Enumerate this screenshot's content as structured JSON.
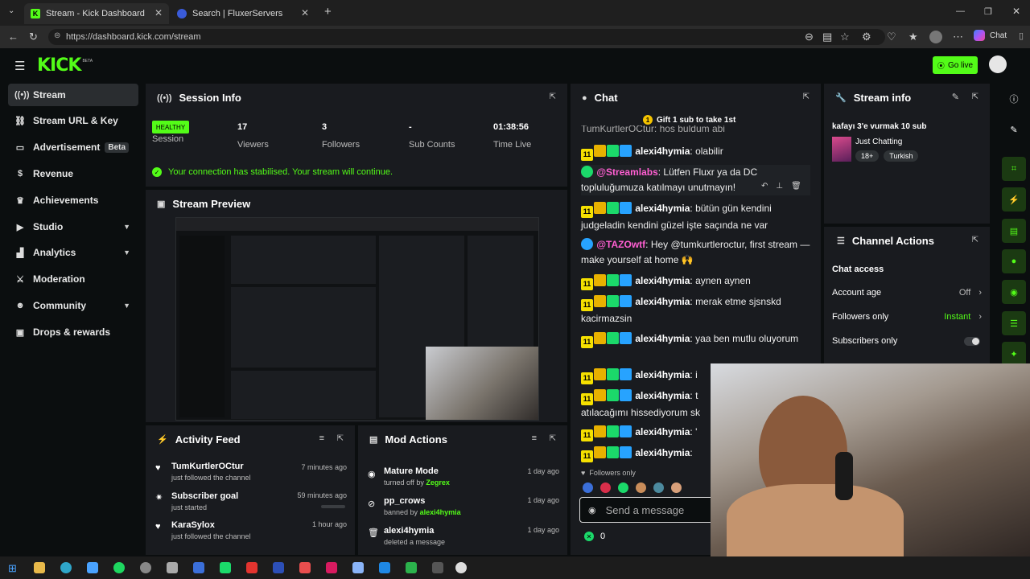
{
  "browser": {
    "tabs": [
      {
        "label": "Stream - Kick Dashboard"
      },
      {
        "label": "Search | FluxerServers"
      }
    ],
    "url": "https://dashboard.kick.com/stream",
    "copilot_label": "Chat"
  },
  "header": {
    "logo": "KICK",
    "logo_sup": "BETA",
    "go_live": "Go live"
  },
  "sidebar": {
    "items": [
      {
        "label": "Stream",
        "icon": "broadcast-icon"
      },
      {
        "label": "Stream URL & Key",
        "icon": "link-icon"
      },
      {
        "label": "Advertisement",
        "badge": "Beta",
        "icon": "tv-icon"
      },
      {
        "label": "Revenue",
        "icon": "dollar-icon"
      },
      {
        "label": "Achievements",
        "icon": "trophy-icon"
      },
      {
        "label": "Studio",
        "icon": "play-icon"
      },
      {
        "label": "Analytics",
        "icon": "chart-icon"
      },
      {
        "label": "Moderation",
        "icon": "sword-icon"
      },
      {
        "label": "Community",
        "icon": "people-icon"
      },
      {
        "label": "Drops & rewards",
        "icon": "gift-icon"
      }
    ]
  },
  "session": {
    "title": "Session Info",
    "health": "HEALTHY",
    "session_label": "Session",
    "viewers": "17",
    "viewers_label": "Viewers",
    "followers": "3",
    "followers_label": "Followers",
    "subs": "-",
    "subs_label": "Sub Counts",
    "time": "01:38:56",
    "time_label": "Time Live",
    "notice": "Your connection has stabilised. Your stream will continue."
  },
  "preview": {
    "title": "Stream Preview"
  },
  "activity": {
    "title": "Activity Feed",
    "items": [
      {
        "title": "TumKurtlerOCtur",
        "sub": "just followed the channel",
        "time": "7 minutes ago"
      },
      {
        "title": "Subscriber goal",
        "sub": "just started",
        "time": "59 minutes ago"
      },
      {
        "title": "KaraSylox",
        "sub": "just followed the channel",
        "time": "1 hour ago"
      }
    ]
  },
  "mod": {
    "title": "Mod Actions",
    "items": [
      {
        "title": "Mature Mode",
        "sub": "turned off by",
        "who": "Zegrex",
        "time": "1 day ago"
      },
      {
        "title": "pp_crows",
        "sub": "banned by",
        "who": "alexi4hymia",
        "time": "1 day ago"
      },
      {
        "title": "alexi4hymia",
        "sub": "deleted a message",
        "who": "",
        "time": "1 day ago"
      }
    ]
  },
  "chat": {
    "title": "Chat",
    "gift": "Gift 1 sub to take 1st",
    "cut_top": "TumKurtlerOCtur: hoş buldum abi",
    "messages": [
      {
        "user": "alexi4hymia",
        "text": "olabilir"
      },
      {
        "user": "@Streamlabs",
        "text": "Lütfen Fluxr ya da DC topluluğumuza katılmayı unutmayın!"
      },
      {
        "user": "alexi4hymia",
        "text": "bütün gün kendini judgeladin kendini güzel işte saçında ne var"
      },
      {
        "user": "@TAZOwtf",
        "text": "Hey @tumkurtleroctur, first stream — make yourself at home 🙌"
      },
      {
        "user": "alexi4hymia",
        "text": "aynen aynen"
      },
      {
        "user": "alexi4hymia",
        "text": "merak etme sjsnskd kacirmazsin"
      },
      {
        "user": "alexi4hymia",
        "text": "yaa ben mutlu oluyorum"
      },
      {
        "user": "alexi4hymia",
        "text": "i"
      },
      {
        "user": "alexi4hymia",
        "text": "t atılacağımı hissediyorum sk"
      },
      {
        "user": "alexi4hymia",
        "text": "'"
      },
      {
        "user": "alexi4hymia",
        "text": ""
      }
    ],
    "followers_only": "Followers only",
    "placeholder": "Send a message",
    "points": "0"
  },
  "stream_info": {
    "title": "Stream info",
    "stream_title": "kafayı 3'e vurmak 10 sub",
    "category": "Just Chatting",
    "tags": [
      "18+",
      "Turkish"
    ]
  },
  "channel_actions": {
    "title": "Channel Actions",
    "section": "Chat access",
    "rows": [
      {
        "label": "Account age",
        "value": "Off"
      },
      {
        "label": "Followers only",
        "value": "Instant"
      },
      {
        "label": "Subscribers only",
        "value": ""
      }
    ]
  },
  "colors": {
    "accent": "#53fc18",
    "panel": "#191b1f",
    "bg": "#0b0e0f"
  }
}
